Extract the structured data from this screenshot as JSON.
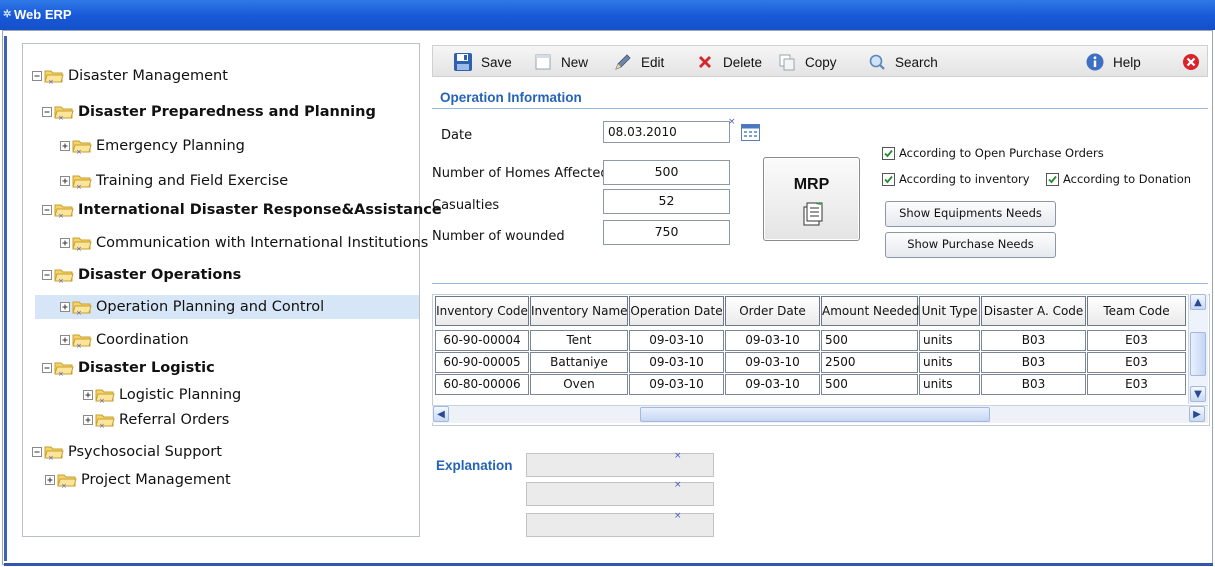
{
  "window": {
    "title": "Web ERP",
    "accent": "#1858d8"
  },
  "tree": {
    "selected_color": "#d7e6f7",
    "nodes": [
      {
        "label": "Disaster Management",
        "bold": false,
        "state": "expanded"
      },
      {
        "label": "Disaster Preparedness and Planning",
        "bold": true,
        "state": "expanded"
      },
      {
        "label": "Emergency Planning",
        "bold": false,
        "state": "collapsed"
      },
      {
        "label": "Training and Field Exercise",
        "bold": false,
        "state": "collapsed"
      },
      {
        "label": "International Disaster Response&Assistance",
        "bold": true,
        "state": "expanded"
      },
      {
        "label": "Communication with International Institutions",
        "bold": false,
        "state": "collapsed"
      },
      {
        "label": "Disaster Operations",
        "bold": true,
        "state": "expanded"
      },
      {
        "label": "Operation Planning and Control",
        "bold": false,
        "state": "collapsed",
        "selected": true
      },
      {
        "label": "Coordination",
        "bold": false,
        "state": "collapsed"
      },
      {
        "label": "Disaster Logistic",
        "bold": true,
        "state": "expanded"
      },
      {
        "label": "Logistic Planning",
        "bold": false,
        "state": "collapsed"
      },
      {
        "label": "Referral Orders",
        "bold": false,
        "state": "collapsed"
      },
      {
        "label": "Psychosocial Support",
        "bold": false,
        "state": "expanded"
      },
      {
        "label": "Project Management",
        "bold": false,
        "state": "collapsed"
      }
    ]
  },
  "toolbar": {
    "save": "Save",
    "new": "New",
    "edit": "Edit",
    "delete": "Delete",
    "copy": "Copy",
    "search": "Search",
    "help": "Help"
  },
  "operation": {
    "section_title": "Operation Information",
    "date_label": "Date",
    "date_value": "08.03.2010",
    "homes_label": "Number of Homes Affected",
    "homes_value": "500",
    "casualties_label": "Casualties",
    "casualties_value": "52",
    "wounded_label": "Number of wounded",
    "wounded_value": "750",
    "mrp_label": "MRP"
  },
  "options": {
    "open_po": {
      "label": "According to Open Purchase Orders",
      "checked": true
    },
    "inventory": {
      "label": "According to inventory",
      "checked": true
    },
    "donation": {
      "label": "According to Donation",
      "checked": true
    },
    "equip_btn": "Show Equipments Needs",
    "purchase_btn": "Show Purchase Needs"
  },
  "grid": {
    "headers": [
      "Inventory Code",
      "Inventory Name",
      "Operation Date",
      "Order Date",
      "Amount Needed",
      "Unit Type",
      "Disaster A. Code",
      "Team Code"
    ],
    "rows": [
      [
        "60-90-00004",
        "Tent",
        "09-03-10",
        "09-03-10",
        "500",
        "units",
        "B03",
        "E03"
      ],
      [
        "60-90-00005",
        "Battaniye",
        "09-03-10",
        "09-03-10",
        "2500",
        "units",
        "B03",
        "E03"
      ],
      [
        "60-80-00006",
        "Oven",
        "09-03-10",
        "09-03-10",
        "500",
        "units",
        "B03",
        "E03"
      ]
    ]
  },
  "explanation": {
    "label": "Explanation",
    "lines": [
      "",
      "",
      ""
    ]
  }
}
